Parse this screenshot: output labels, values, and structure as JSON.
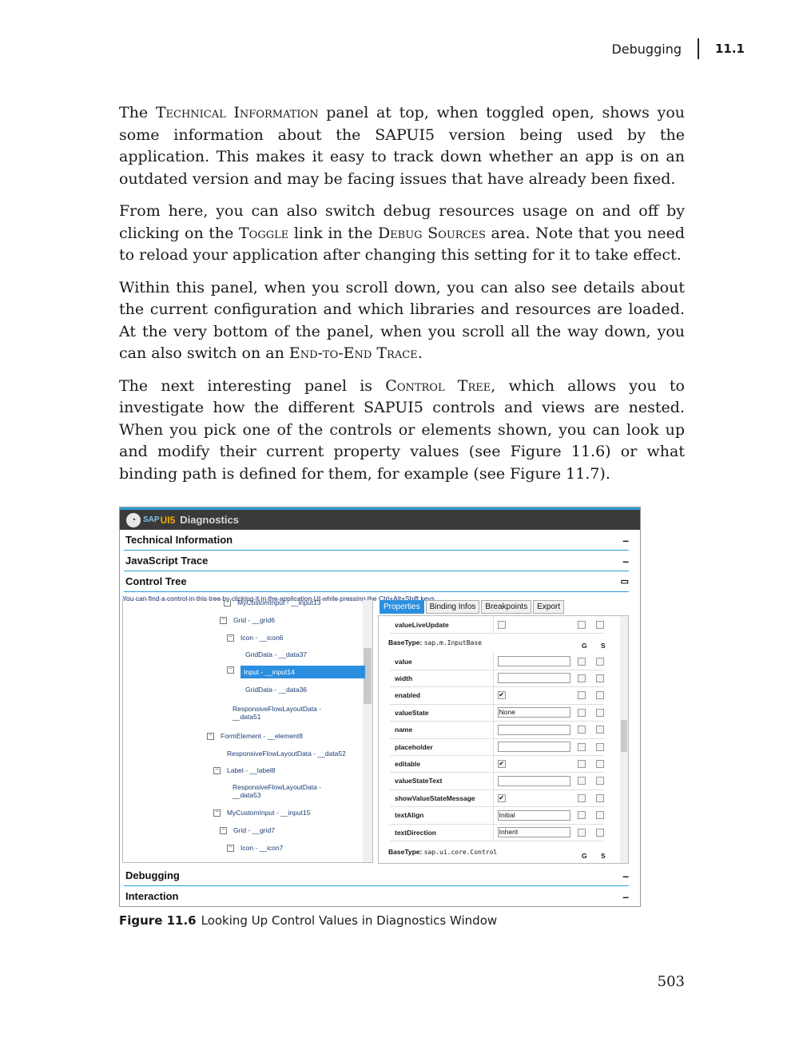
{
  "header": {
    "section_title": "Debugging",
    "section_number": "11.1"
  },
  "paragraphs": {
    "p1": {
      "t1": "The ",
      "sc1": "Technical Information",
      "t2": " panel at top, when toggled open, shows you some information about the SAPUI5 version being used by the application. This makes it easy to track down whether an app is on an outdated version and may be facing issues that have already been fixed."
    },
    "p2": {
      "t1": "From here, you can also switch debug resources usage on and off by clicking on the ",
      "sc1": "Toggle",
      "t2": " link in the ",
      "sc2": "Debug Sources",
      "t3": " area. Note that you need to reload your application after changing this setting for it to take effect."
    },
    "p3": {
      "t1": "Within this panel, when you scroll down, you can also see details about the current configuration and which libraries and resources are loaded. At the very bottom of the panel, when you scroll all the way down, you can also switch on an ",
      "sc1": "End-to-End Trace",
      "t2": "."
    },
    "p4": {
      "t1": "The next interesting panel is ",
      "sc1": "Control Tree",
      "t2": ", which allows you to investigate how the different SAPUI5 controls and views are nested. When you pick one of the controls or elements shown, you can look up and modify their current property values (see Figure 11.6) or what binding path is defined for them, for example (see Figure 11.7)."
    }
  },
  "figure": {
    "window_title": "Diagnostics",
    "logo": {
      "sap": "SAP",
      "ui5": "UI5"
    },
    "sections": {
      "technical_information": "Technical Information",
      "javascript_trace": "JavaScript Trace",
      "control_tree": "Control Tree",
      "debugging": "Debugging",
      "interaction": "Interaction"
    },
    "toggle_symbol": "–",
    "hint": "You can find a control in this tree by clicking it in the application UI while pressing the Ctrl+Alt+Shift keys.",
    "tree": [
      {
        "label": "MyCustomInput - __input13",
        "expandable": true
      },
      {
        "label": "Grid - __grid6",
        "expandable": true
      },
      {
        "label": "Icon - __icon6",
        "expandable": true
      },
      {
        "label": "GridData - __data37",
        "expandable": false
      },
      {
        "label": "Input - __input14",
        "expandable": true,
        "selected": true
      },
      {
        "label": "GridData - __data36",
        "expandable": false
      },
      {
        "label": "ResponsiveFlowLayoutData -",
        "expandable": false
      },
      {
        "label": "__data51",
        "expandable": false
      },
      {
        "label": "FormElement - __element8",
        "expandable": true
      },
      {
        "label": "ResponsiveFlowLayoutData - __data52",
        "expandable": false
      },
      {
        "label": "Label - __label8",
        "expandable": true
      },
      {
        "label": "ResponsiveFlowLayoutData -",
        "expandable": false
      },
      {
        "label": "__data53",
        "expandable": false
      },
      {
        "label": "MyCustomInput - __input15",
        "expandable": true
      },
      {
        "label": "Grid - __grid7",
        "expandable": true
      },
      {
        "label": "Icon - __icon7",
        "expandable": true
      }
    ],
    "tabs": [
      "Properties",
      "Binding Infos",
      "Breakpoints",
      "Export"
    ],
    "top_row": {
      "name": "valueLiveUpdate"
    },
    "basetype1": {
      "label": "BaseType:",
      "value": "sap.m.InputBase"
    },
    "basetype2": {
      "label": "BaseType:",
      "value": "sap.ui.core.Control"
    },
    "col_g": "G",
    "col_s": "S",
    "properties": [
      {
        "name": "value",
        "type": "input",
        "value": ""
      },
      {
        "name": "width",
        "type": "input",
        "value": ""
      },
      {
        "name": "enabled",
        "type": "check",
        "checked": true
      },
      {
        "name": "valueState",
        "type": "input",
        "value": "None"
      },
      {
        "name": "name",
        "type": "input",
        "value": ""
      },
      {
        "name": "placeholder",
        "type": "input",
        "value": ""
      },
      {
        "name": "editable",
        "type": "check",
        "checked": true
      },
      {
        "name": "valueStateText",
        "type": "input",
        "value": ""
      },
      {
        "name": "showValueStateMessage",
        "type": "check",
        "checked": true
      },
      {
        "name": "textAlign",
        "type": "input",
        "value": "Initial"
      },
      {
        "name": "textDirection",
        "type": "input",
        "value": "Inherit"
      }
    ],
    "checkmark": "✔",
    "expander": "⊟",
    "restore_symbol": "▭"
  },
  "caption": {
    "label": "Figure 11.6",
    "text": "Looking Up Control Values in Diagnostics Window"
  },
  "page_number": "503",
  "colors": {
    "accent": "#2a9fd8",
    "selected": "#2b8fe0",
    "titlebar": "#3a3a3a"
  }
}
